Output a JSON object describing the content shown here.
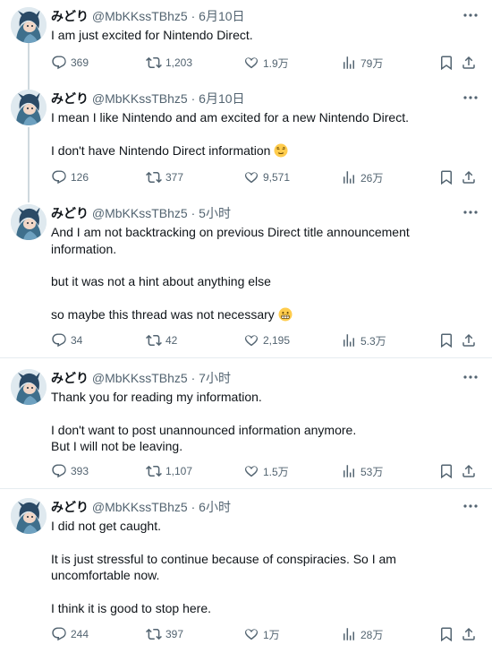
{
  "icons": [
    "avatar-illustration",
    "more-icon",
    "reply-icon",
    "retweet-icon",
    "like-icon",
    "views-icon",
    "bookmark-icon",
    "share-icon",
    "relieved-face-emoji",
    "grimacing-face-emoji"
  ],
  "colors": {
    "text": "#0f1419",
    "secondary": "#536471",
    "thread_line": "#cfd9de",
    "divider": "#e6ecf0"
  },
  "tweets": [
    {
      "name": "みどり",
      "handle": "@MbKKssTBhz5",
      "time": "6月10日",
      "separator": "·",
      "paragraphs": [
        "I am just excited for Nintendo Direct."
      ],
      "replies": "369",
      "retweets": "1,203",
      "likes": "1.9万",
      "views": "79万"
    },
    {
      "name": "みどり",
      "handle": "@MbKKssTBhz5",
      "time": "6月10日",
      "separator": "·",
      "paragraphs": [
        "I mean I like Nintendo and am excited for a new Nintendo Direct.",
        "I don't have Nintendo Direct information"
      ],
      "replies": "126",
      "retweets": "377",
      "likes": "9,571",
      "views": "26万"
    },
    {
      "name": "みどり",
      "handle": "@MbKKssTBhz5",
      "time": "5小时",
      "separator": "·",
      "paragraphs": [
        "And I am not backtracking on previous Direct title announcement information.",
        "but it was not a hint about anything else",
        "so maybe this thread was not necessary"
      ],
      "replies": "34",
      "retweets": "42",
      "likes": "2,195",
      "views": "5.3万"
    },
    {
      "name": "みどり",
      "handle": "@MbKKssTBhz5",
      "time": "7小时",
      "separator": "·",
      "paragraphs": [
        "Thank you for reading my information.",
        "I don't want to post unannounced information anymore.",
        "But I will not be leaving."
      ],
      "replies": "393",
      "retweets": "1,107",
      "likes": "1.5万",
      "views": "53万"
    },
    {
      "name": "みどり",
      "handle": "@MbKKssTBhz5",
      "time": "6小时",
      "separator": "·",
      "paragraphs": [
        "I did not get caught.",
        "It is just stressful to continue because of conspiracies. So I am uncomfortable now.",
        "I think it is good to stop here."
      ],
      "replies": "244",
      "retweets": "397",
      "likes": "1万",
      "views": "28万"
    }
  ]
}
